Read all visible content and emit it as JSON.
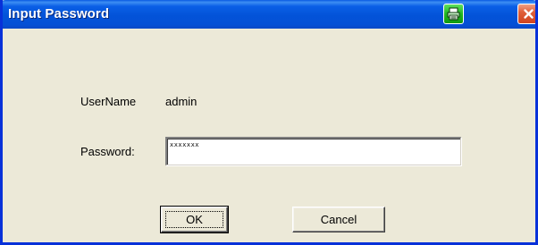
{
  "window": {
    "title": "Input Password",
    "title_bar_buttons": [
      {
        "icon": "printer-icon",
        "color": "#22b822"
      },
      {
        "icon": "close-icon",
        "color": "#d0451f"
      }
    ]
  },
  "form": {
    "username_label": "UserName",
    "username_value": "admin",
    "password_label": "Password:",
    "password_value": "xxxxxxx"
  },
  "buttons": {
    "ok_label": "OK",
    "cancel_label": "Cancel"
  },
  "colors": {
    "title_bar": "#0353d8",
    "dialog_background": "#ece9d8"
  }
}
